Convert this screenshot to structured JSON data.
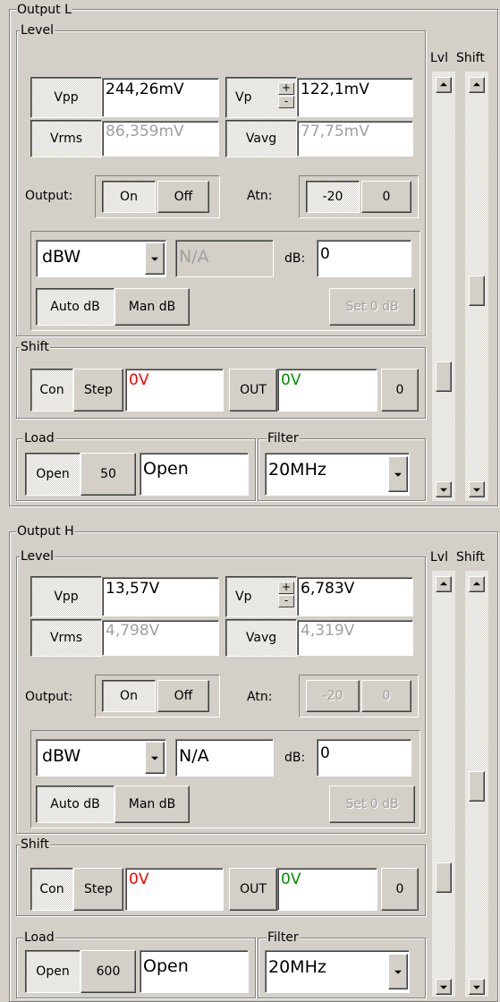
{
  "panels": [
    {
      "title": "Output L",
      "level_title": "Level",
      "vpp_label": "Vpp",
      "vpp_value": "244,26mV",
      "vp_label": "Vp",
      "vp_value": "122,1mV",
      "plus": "+",
      "minus": "-",
      "vrms_label": "Vrms",
      "vrms_value": "86,359mV",
      "vavg_label": "Vavg",
      "vavg_value": "77,75mV",
      "output_label": "Output:",
      "on_label": "On",
      "off_label": "Off",
      "atn_label": "Atn:",
      "atn_minus20": "-20",
      "atn_0": "0",
      "unit_select": "dBW",
      "unit_value": "N/A",
      "db_label": "dB:",
      "db_value": "0",
      "auto_db": "Auto dB",
      "man_db": "Man dB",
      "set0db": "Set 0 dB",
      "shift_title": "Shift",
      "con": "Con",
      "step": "Step",
      "shift_value": "0V",
      "out_label": "OUT",
      "out_value": "0V",
      "zero": "0",
      "load_title": "Load",
      "open_btn": "Open",
      "load_btn": "50",
      "load_value": "Open",
      "filter_title": "Filter",
      "filter_value": "20MHz",
      "lvl_label": "Lvl",
      "shift_label": "Shift"
    },
    {
      "title": "Output H",
      "level_title": "Level",
      "vpp_label": "Vpp",
      "vpp_value": "13,57V",
      "vp_label": "Vp",
      "vp_value": "6,783V",
      "plus": "+",
      "minus": "-",
      "vrms_label": "Vrms",
      "vrms_value": "4,798V",
      "vavg_label": "Vavg",
      "vavg_value": "4,319V",
      "output_label": "Output:",
      "on_label": "On",
      "off_label": "Off",
      "atn_label": "Atn:",
      "atn_minus20": "-20",
      "atn_0": "0",
      "unit_select": "dBW",
      "unit_value": "N/A",
      "db_label": "dB:",
      "db_value": "0",
      "auto_db": "Auto dB",
      "man_db": "Man dB",
      "set0db": "Set 0 dB",
      "shift_title": "Shift",
      "con": "Con",
      "step": "Step",
      "shift_value": "0V",
      "out_label": "OUT",
      "out_value": "0V",
      "zero": "0",
      "load_title": "Load",
      "open_btn": "Open",
      "load_btn": "600",
      "load_value": "Open",
      "filter_title": "Filter",
      "filter_value": "20MHz",
      "lvl_label": "Lvl",
      "shift_label": "Shift"
    }
  ]
}
